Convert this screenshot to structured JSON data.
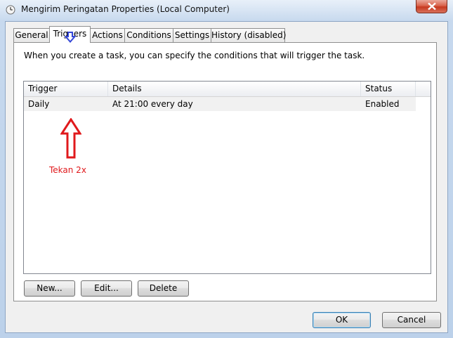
{
  "window": {
    "title": "Mengirim Peringatan Properties (Local Computer)"
  },
  "tabs": [
    {
      "label": "General",
      "active": false
    },
    {
      "label": "Triggers",
      "active": true
    },
    {
      "label": "Actions",
      "active": false
    },
    {
      "label": "Conditions",
      "active": false
    },
    {
      "label": "Settings",
      "active": false
    },
    {
      "label": "History (disabled)",
      "active": false
    }
  ],
  "triggers_tab": {
    "description": "When you create a task, you can specify the conditions that will trigger the task.",
    "columns": [
      "Trigger",
      "Details",
      "Status"
    ],
    "rows": [
      {
        "trigger": "Daily",
        "details": "At 21:00 every day",
        "status": "Enabled"
      }
    ],
    "buttons": {
      "new": "New...",
      "edit": "Edit...",
      "delete": "Delete"
    }
  },
  "annotation": {
    "text": "Tekan 2x",
    "color": "#e0191c",
    "tab_arrow_color": "#3346d6"
  },
  "dialog_buttons": {
    "ok": "OK",
    "cancel": "Cancel"
  },
  "icons": {
    "title": "clock-icon",
    "close": "close-icon"
  }
}
